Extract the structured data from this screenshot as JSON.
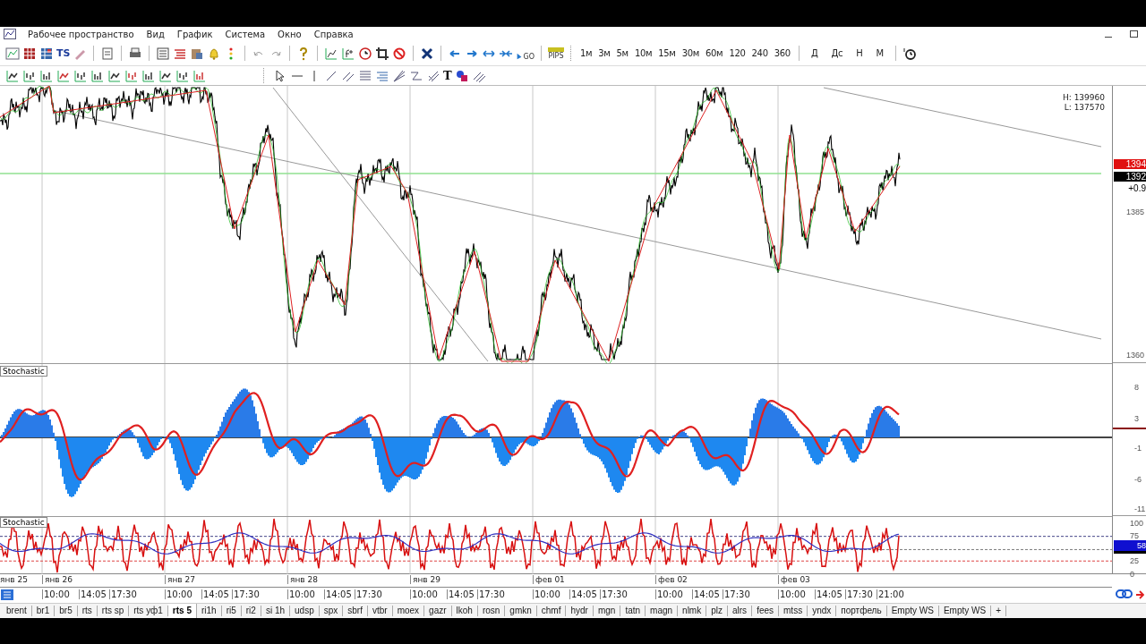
{
  "menu": [
    "Рабочее пространство",
    "Вид",
    "График",
    "Система",
    "Окно",
    "Справка"
  ],
  "toolbar": {
    "ts_label": "TS",
    "go_label": "GO",
    "pips_label": "PIPS",
    "text_tool": "T",
    "timeframes": [
      "1м",
      "3м",
      "5м",
      "10м",
      "15м",
      "30м",
      "60м",
      "120",
      "240",
      "360"
    ],
    "periods": [
      "Д",
      "Дс",
      "Н",
      "М"
    ]
  },
  "price_panel": {
    "high_low": [
      "H: 139960",
      "L: 137570"
    ],
    "axis": [
      "1385",
      "1360"
    ],
    "tags": [
      {
        "text": "1394",
        "color": "#e01010"
      },
      {
        "text": "1392",
        "color": "#000000"
      },
      {
        "text": "+0.9",
        "color": "#ffffff"
      }
    ]
  },
  "indicators": [
    {
      "kind": "histogram",
      "title": "Stochastic",
      "axis": [
        "8",
        "3",
        "-1",
        "-6",
        "-11"
      ]
    },
    {
      "kind": "oscillator",
      "title": "Stochastic",
      "axis": [
        "100",
        "75",
        {
          "text": "58",
          "kind": "tag"
        },
        "25",
        "0"
      ]
    }
  ],
  "days": [
    {
      "date": "янв 25"
    },
    {
      "date": "янв 26",
      "times": [
        "10:00",
        "14:05",
        "17:30"
      ]
    },
    {
      "date": "янв 27",
      "times": [
        "10:00",
        "14:05",
        "17:30"
      ]
    },
    {
      "date": "янв 28",
      "times": [
        "10:00",
        "14:05",
        "17:30"
      ]
    },
    {
      "date": "янв 29",
      "times": [
        "10:00",
        "14:05",
        "17:30"
      ]
    },
    {
      "date": "фев 01",
      "times": [
        "10:00",
        "14:05",
        "17:30"
      ]
    },
    {
      "date": "фев 02",
      "times": [
        "10:00",
        "14:05",
        "17:30"
      ]
    },
    {
      "date": "фев 03",
      "times": [
        "10:00",
        "14:05",
        "17:30",
        "21:00"
      ]
    }
  ],
  "tabs": [
    {
      "label": "brent",
      "selected": false
    },
    {
      "label": "br1",
      "selected": false
    },
    {
      "label": "br5",
      "selected": false
    },
    {
      "label": "rts",
      "selected": false
    },
    {
      "label": "rts sp",
      "selected": false
    },
    {
      "label": "rts уф1",
      "selected": false
    },
    {
      "label": "rts 5",
      "selected": true
    },
    {
      "label": "ri1h",
      "selected": false
    },
    {
      "label": "ri5",
      "selected": false
    },
    {
      "label": "ri2",
      "selected": false
    },
    {
      "label": "si 1h",
      "selected": false
    },
    {
      "label": "udsp",
      "selected": false
    },
    {
      "label": "spx",
      "selected": false
    },
    {
      "label": "sbrf",
      "selected": false
    },
    {
      "label": "vtbr",
      "selected": false
    },
    {
      "label": "moex",
      "selected": false
    },
    {
      "label": "gazr",
      "selected": false
    },
    {
      "label": "lkoh",
      "selected": false
    },
    {
      "label": "rosn",
      "selected": false
    },
    {
      "label": "gmkn",
      "selected": false
    },
    {
      "label": "chmf",
      "selected": false
    },
    {
      "label": "hydr",
      "selected": false
    },
    {
      "label": "mgn",
      "selected": false
    },
    {
      "label": "tatn",
      "selected": false
    },
    {
      "label": "magn",
      "selected": false
    },
    {
      "label": "nlmk",
      "selected": false
    },
    {
      "label": "plz",
      "selected": false
    },
    {
      "label": "alrs",
      "selected": false
    },
    {
      "label": "fees",
      "selected": false
    },
    {
      "label": "mtss",
      "selected": false
    },
    {
      "label": "yndx",
      "selected": false
    },
    {
      "label": "портфель",
      "selected": false
    },
    {
      "label": "Empty WS",
      "selected": false
    },
    {
      "label": "Empty WS",
      "selected": false
    },
    {
      "label": "+",
      "selected": false
    }
  ]
}
